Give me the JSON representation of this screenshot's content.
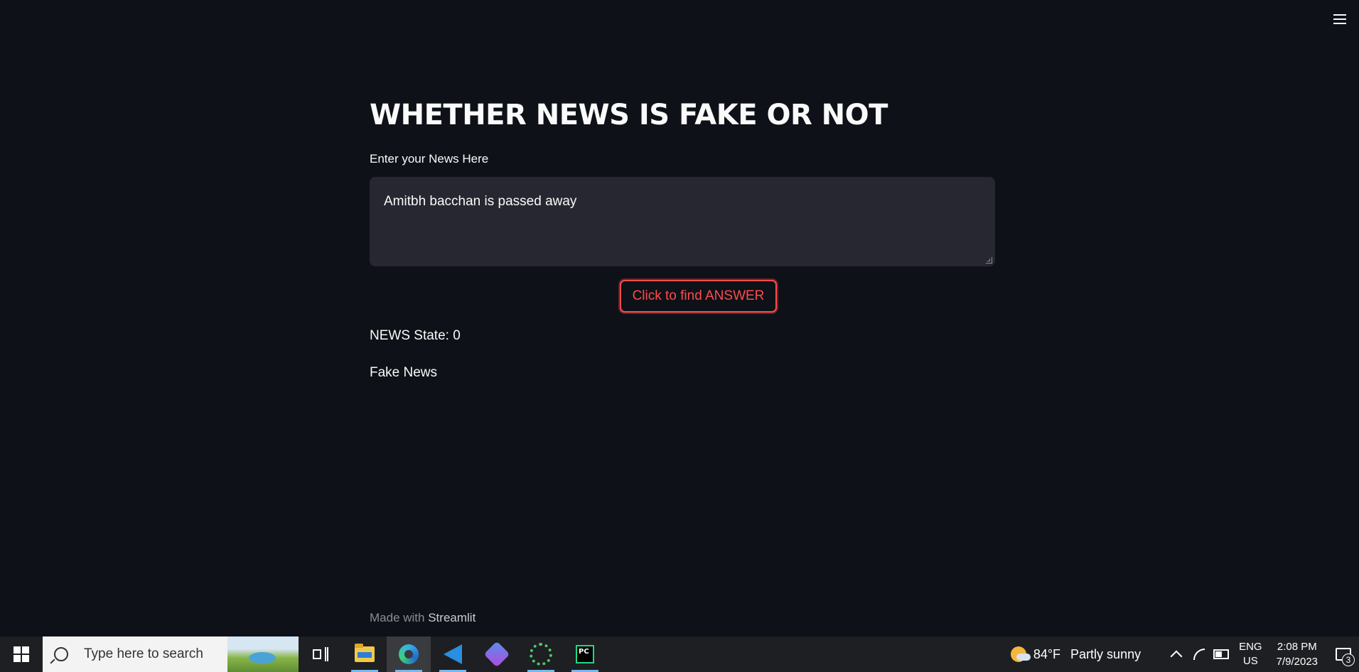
{
  "app": {
    "title": "WHETHER NEWS IS FAKE OR NOT",
    "input_label": "Enter your News Here",
    "input_value": "Amitbh bacchan is passed away",
    "button_label": "Click to find ANSWER",
    "state_text": "NEWS State: 0",
    "result_text": "Fake News",
    "footer_prefix": "Made with",
    "footer_brand": "Streamlit",
    "accent_color": "#ff4b4b"
  },
  "taskbar": {
    "search_placeholder": "Type here to search",
    "apps": [
      "task-view-icon",
      "file-explorer-icon",
      "edge-icon",
      "vscode-icon",
      "copilot-icon",
      "spinner-app-icon",
      "pycharm-icon"
    ],
    "pycharm_label": "PC",
    "weather_temp": "84°F",
    "weather_desc": "Partly sunny",
    "lang_line1": "ENG",
    "lang_line2": "US",
    "time": "2:08 PM",
    "date": "7/9/2023",
    "notification_count": "3"
  }
}
